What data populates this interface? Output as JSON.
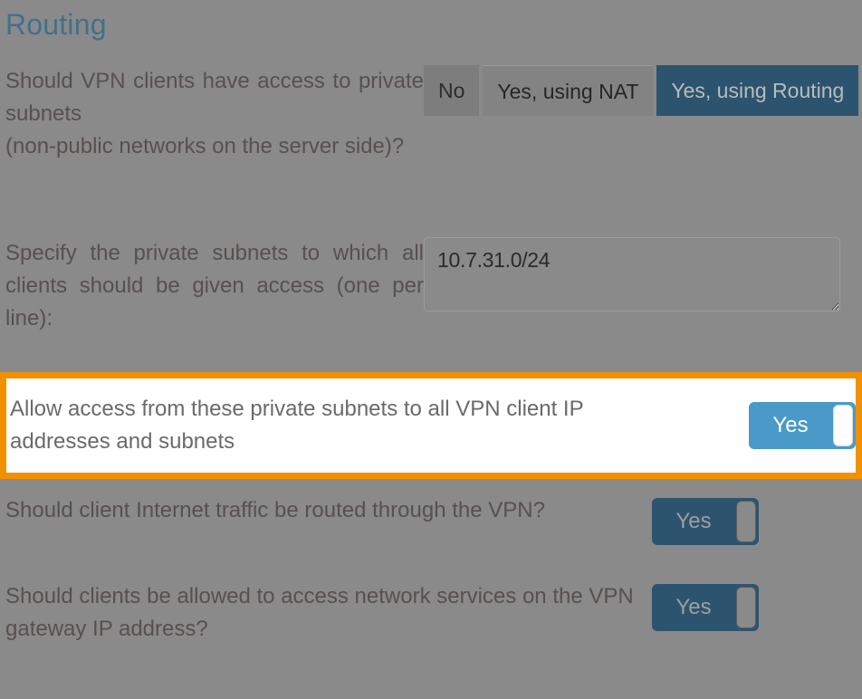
{
  "section": {
    "title": "Routing"
  },
  "rows": {
    "access": {
      "question_line1": "Should VPN clients have access to private subnets",
      "question_line2": "(non-public networks on the server side)?",
      "options": [
        {
          "label": "No",
          "selected": false
        },
        {
          "label": "Yes, using NAT",
          "selected": false
        },
        {
          "label": "Yes, using Routing",
          "selected": true
        }
      ]
    },
    "subnets": {
      "question": "Specify the private subnets to which all clients should be given access (one per line):",
      "textarea_value": "10.7.31.0/24",
      "textarea_placeholder": ""
    },
    "allow_access": {
      "question": "Allow access from these private subnets to all VPN client IP addresses and subnets",
      "toggle_label": "Yes",
      "highlighted": true
    },
    "internet_traffic": {
      "question": "Should client Internet traffic be routed through the VPN?",
      "toggle_label": "Yes"
    },
    "gateway_services": {
      "question": "Should clients be allowed to access network services on the VPN gateway IP address?",
      "toggle_label": "Yes"
    }
  },
  "colors": {
    "page_background": "#8a8a8a",
    "title_blue": "#41708b",
    "selected_button": "#2d546e",
    "highlight_border": "#f29100",
    "active_toggle": "#4a9ac9",
    "dim_toggle": "#2d546e",
    "question_text": "#57504f"
  }
}
